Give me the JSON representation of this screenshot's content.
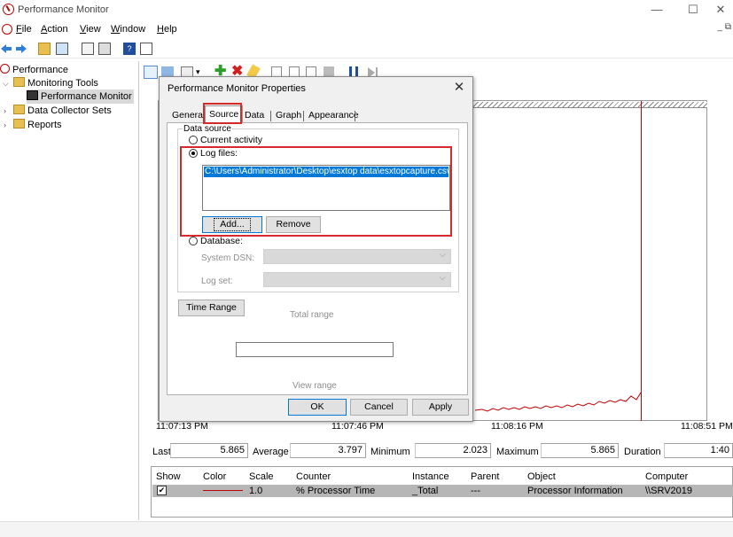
{
  "window": {
    "title": "Performance Monitor",
    "controls": [
      "—",
      "☐",
      "✕"
    ],
    "mdi_controls": "_ ⧉"
  },
  "menu": [
    "File",
    "Action",
    "View",
    "Window",
    "Help"
  ],
  "tree": {
    "root": "Performance",
    "monitoring_tools": "Monitoring Tools",
    "performance_monitor": "Performance Monitor",
    "data_collector_sets": "Data Collector Sets",
    "reports": "Reports"
  },
  "chart": {
    "time_labels": [
      "11:07:13 PM",
      "11:07:46 PM",
      "11:08:16 PM",
      "11:08:51 PM"
    ],
    "line_color": "#c00000"
  },
  "stats": {
    "last_label": "Last",
    "last_value": "5.865",
    "average_label": "Average",
    "average_value": "3.797",
    "minimum_label": "Minimum",
    "minimum_value": "2.023",
    "maximum_label": "Maximum",
    "maximum_value": "5.865",
    "duration_label": "Duration",
    "duration_value": "1:40"
  },
  "counters": {
    "headers": [
      "Show",
      "Color",
      "Scale",
      "Counter",
      "Instance",
      "Parent",
      "Object",
      "Computer"
    ],
    "rows": [
      {
        "show": "✔",
        "scale": "1.0",
        "counter": "% Processor Time",
        "instance": "_Total",
        "parent": "---",
        "object": "Processor Information",
        "computer": "\\\\SRV2019"
      }
    ]
  },
  "dialog": {
    "title": "Performance Monitor Properties",
    "close": "✕",
    "tabs": [
      "General",
      "Source",
      "Data",
      "Graph",
      "Appearance"
    ],
    "active_tab": "Source",
    "data_source_label": "Data source",
    "current_activity": "Current activity",
    "log_files": "Log files:",
    "log_file_path": "C:\\Users\\Administrator\\Desktop\\esxtop data\\esxtopcapture.csv",
    "add_button": "Add...",
    "remove_button": "Remove",
    "database": "Database:",
    "system_dsn": "System DSN:",
    "log_set": "Log set:",
    "time_range_button": "Time Range",
    "total_range": "Total range",
    "view_range": "View range",
    "ok": "OK",
    "cancel": "Cancel",
    "apply": "Apply"
  }
}
